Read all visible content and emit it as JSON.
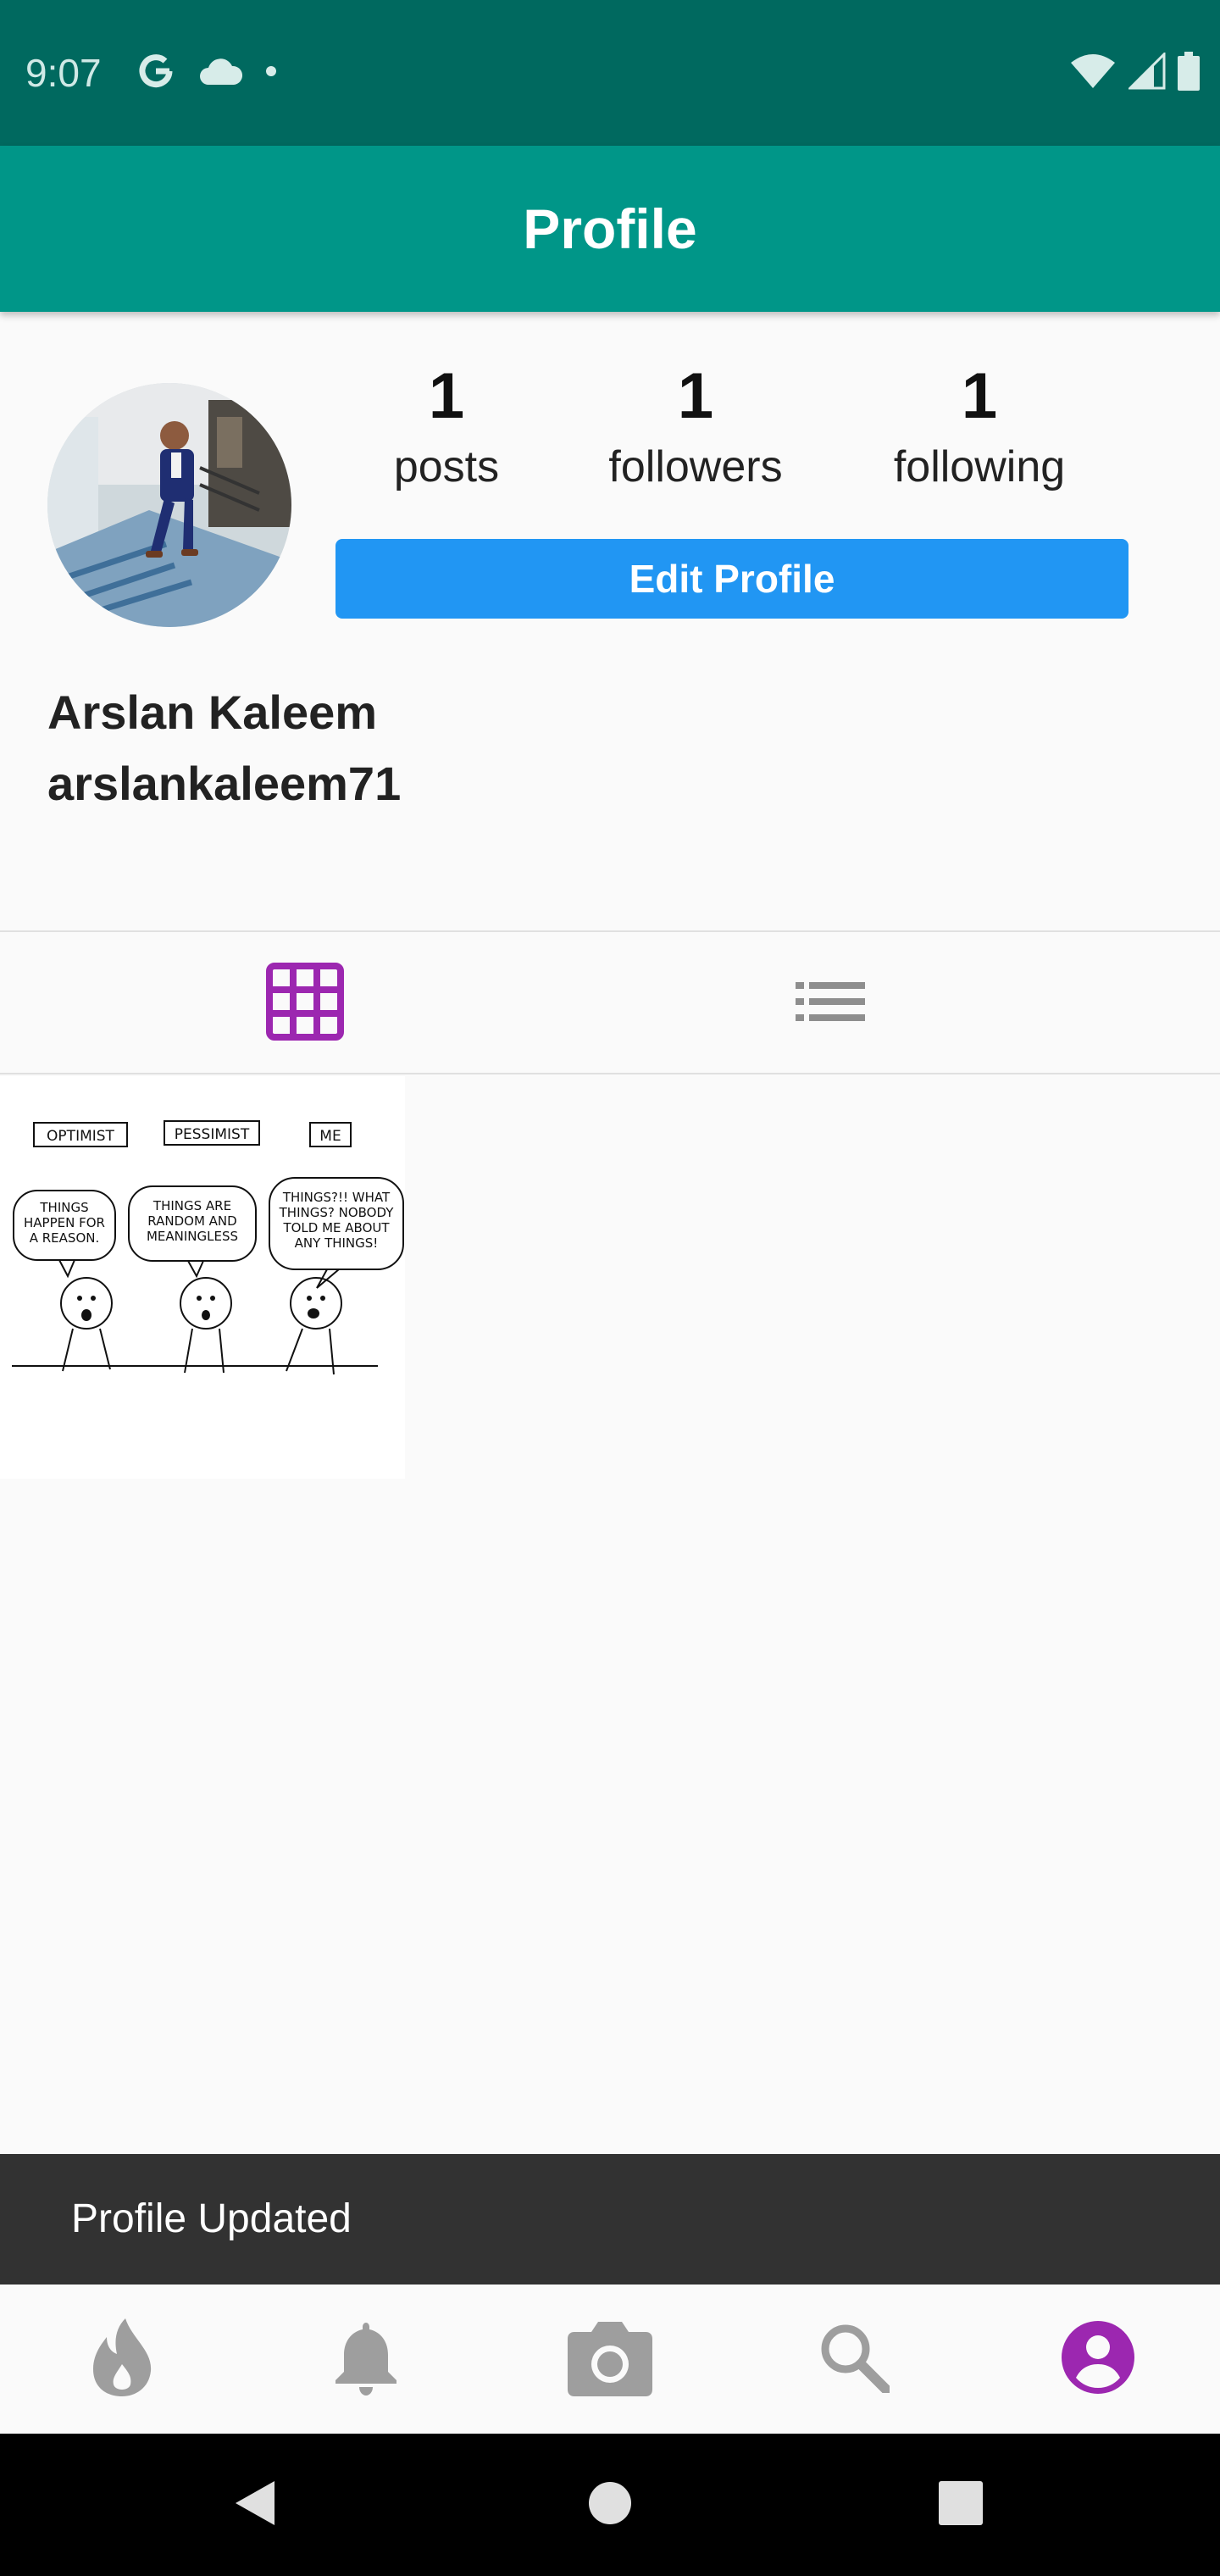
{
  "status_bar": {
    "time": "9:07",
    "left_icons": [
      "google-icon",
      "cloud-icon",
      "dot-icon"
    ],
    "right_icons": [
      "wifi-icon",
      "signal-icon",
      "battery-icon"
    ]
  },
  "app_bar": {
    "title": "Profile"
  },
  "profile": {
    "avatar": "avatar",
    "full_name": "Arslan Kaleem",
    "username": "arslankaleem71",
    "edit_button_label": "Edit Profile",
    "stats": [
      {
        "count": "1",
        "label": "posts"
      },
      {
        "count": "1",
        "label": "followers"
      },
      {
        "count": "1",
        "label": "following"
      }
    ]
  },
  "tabs": [
    {
      "icon": "grid-icon",
      "active": true
    },
    {
      "icon": "list-icon",
      "active": false
    }
  ],
  "posts": [
    {
      "labels": [
        "OPTIMIST",
        "PESSIMIST",
        "ME"
      ],
      "bubbles": [
        [
          "THINGS",
          "HAPPEN FOR",
          "A REASON."
        ],
        [
          "THINGS ARE",
          "RANDOM AND",
          "MEANINGLESS"
        ],
        [
          "THINGS?!! WHAT",
          "THINGS? NOBODY",
          "TOLD ME ABOUT",
          "ANY THINGS!"
        ]
      ]
    }
  ],
  "snackbar": {
    "message": "Profile Updated"
  },
  "bottom_nav": [
    {
      "icon": "flame-icon",
      "active": false
    },
    {
      "icon": "bell-icon",
      "active": false
    },
    {
      "icon": "camera-icon",
      "active": false
    },
    {
      "icon": "search-icon",
      "active": false
    },
    {
      "icon": "account-circle-icon",
      "active": true
    }
  ],
  "system_nav": [
    "back-icon",
    "home-icon",
    "recents-icon"
  ],
  "colors": {
    "status_bar": "#00695f",
    "app_bar": "#009688",
    "edit_button": "#2196f3",
    "active_accent": "#9c27b0",
    "inactive_icon": "#9e9e9e",
    "snackbar": "#323232"
  }
}
